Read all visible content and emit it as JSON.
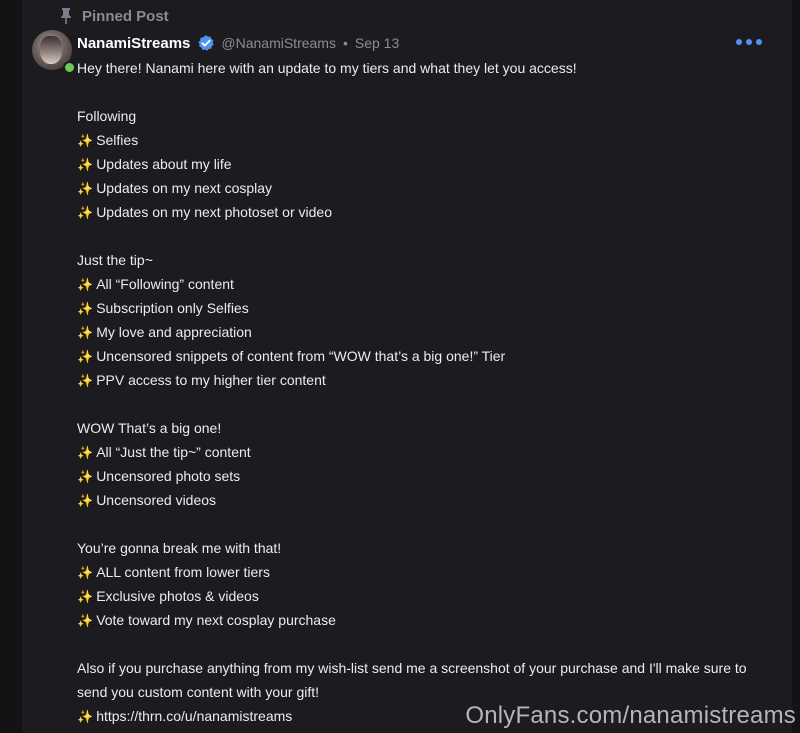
{
  "pinned_label": "Pinned Post",
  "author": {
    "name": "NanamiStreams",
    "handle": "@NanamiStreams",
    "date": "Sep 13"
  },
  "post": {
    "intro": "Hey there! Nanami here with an update to my tiers and what they let you access!",
    "tiers": [
      {
        "title": "Following",
        "items": [
          "Selfies",
          "Updates about my life",
          "Updates on my next cosplay",
          "Updates on my next photoset or video"
        ]
      },
      {
        "title": "Just the tip~",
        "items": [
          "All “Following” content",
          "Subscription only Selfies",
          "My love and appreciation",
          "Uncensored snippets of content from “WOW that’s a big one!” Tier",
          "PPV access to my higher tier content"
        ]
      },
      {
        "title": "WOW That’s a big one!",
        "items": [
          "All “Just the tip~” content",
          "Uncensored photo sets",
          "Uncensored videos"
        ]
      },
      {
        "title": "You’re gonna break me with that!",
        "items": [
          "ALL content from lower tiers",
          "Exclusive photos & videos",
          "Vote toward my next cosplay purchase"
        ]
      }
    ],
    "outro_line1": "Also if you purchase anything from my wish-list send me a screenshot of your purchase and I'll make sure to",
    "outro_line2": "send you custom content with your gift!",
    "link": "https://thrn.co/u/nanamistreams"
  },
  "sparkle_glyph": "✨",
  "watermark": "OnlyFans.com/nanamistreams",
  "colors": {
    "background": "#131316",
    "card": "#1c1c20",
    "accent": "#4d94f0",
    "online": "#6cc95a",
    "muted": "#8c8c99"
  },
  "icons": [
    "pin-icon",
    "verified-badge-icon",
    "more-options-icon"
  ]
}
